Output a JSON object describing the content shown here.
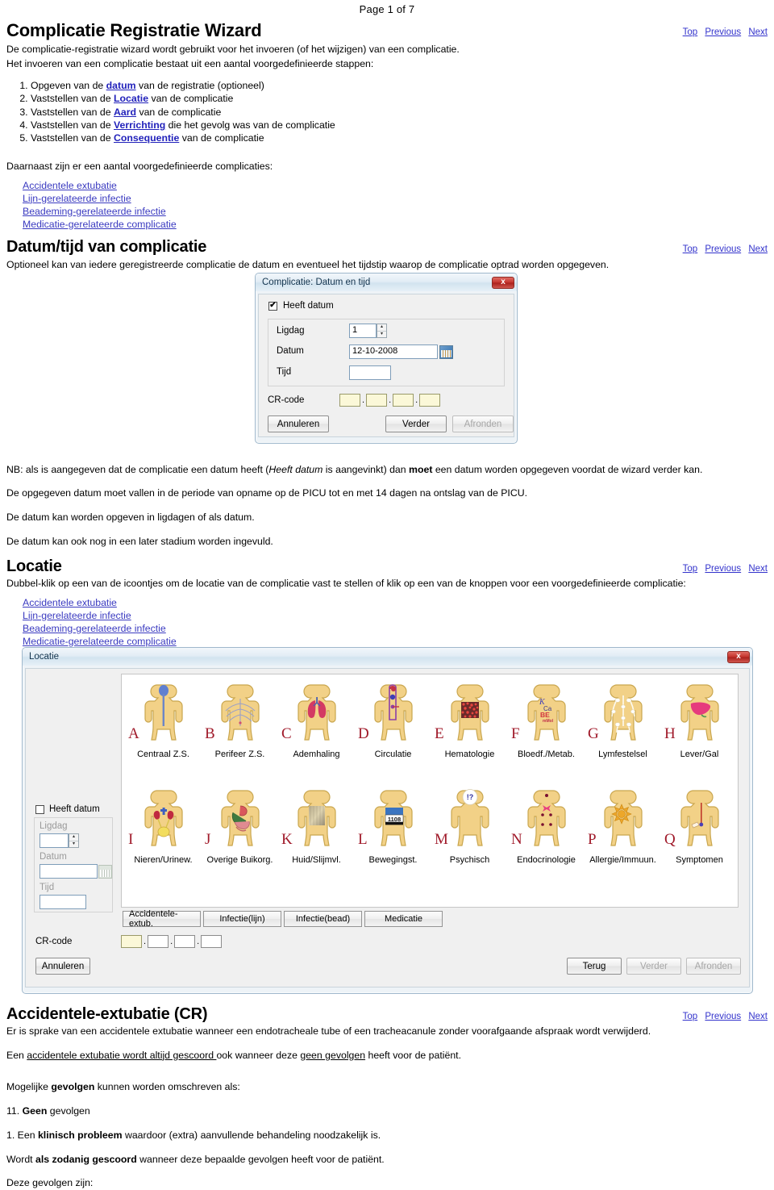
{
  "page_label": "Page 1 of 7",
  "nav": {
    "top": "Top",
    "previous": "Previous",
    "next": "Next"
  },
  "section1": {
    "title": "Complicatie Registratie Wizard",
    "intro_line1": "De complicatie-registratie wizard wordt gebruikt voor het invoeren (of het wijzigen) van een complicatie.",
    "intro_line2": "Het invoeren van een complicatie bestaat uit een aantal voorgedefinieerde stappen:",
    "steps": [
      {
        "pre": "Opgeven van de ",
        "link": "datum",
        "post": " van de registratie (optioneel)"
      },
      {
        "pre": "Vaststellen van de ",
        "link": "Locatie",
        "post": " van de complicatie"
      },
      {
        "pre": "Vaststellen van de ",
        "link": "Aard",
        "post": " van de complicatie"
      },
      {
        "pre": "Vaststellen van de ",
        "link": "Verrichting",
        "post": " die het gevolg was van de complicatie"
      },
      {
        "pre": "Vaststellen van de ",
        "link": "Consequentie",
        "post": " van de complicatie"
      }
    ],
    "predef_intro": "Daarnaast zijn er een aantal voorgedefinieerde complicaties:",
    "predef_links": [
      "Accidentele extubatie",
      "Lijn-gerelateerde infectie",
      "Beademing-gerelateerde infectie",
      "Medicatie-gerelateerde complicatie"
    ]
  },
  "section2": {
    "title": "Datum/tijd van complicatie",
    "intro": "Optioneel kan van iedere geregistreerde complicatie de datum en eventueel het tijdstip waarop de complicatie optrad worden opgegeven.",
    "notes": [
      {
        "p1": "NB: als is aangegeven dat de complicatie een datum heeft (",
        "i": "Heeft datum",
        "p2": " is aangevinkt) dan ",
        "b": "moet",
        "p3": " een datum worden opgegeven voordat de wizard verder kan."
      },
      {
        "p1": "De opgegeven datum moet vallen in de periode van opname op de PICU tot en met 14 dagen na ontslag van de PICU."
      },
      {
        "p1": "De datum kan worden opgeven in ligdagen of als datum."
      },
      {
        "p1": "De datum kan ook nog in een later stadium worden ingevuld."
      }
    ]
  },
  "dialog_datum": {
    "title": "Complicatie: Datum en tijd",
    "close_label": "x",
    "checkbox_label": "Heeft datum",
    "checkbox_checked": "✔",
    "fields": [
      {
        "label": "Ligdag",
        "value": "1"
      },
      {
        "label": "Datum",
        "value": "12-10-2008"
      },
      {
        "label": "Tijd",
        "value": ""
      }
    ],
    "crcode_label": "CR-code",
    "crcode_values": [
      "",
      "",
      "",
      ""
    ],
    "buttons": {
      "cancel": "Annuleren",
      "next": "Verder",
      "finish": "Afronden"
    }
  },
  "section3": {
    "title": "Locatie",
    "intro": "Dubbel-klik op een van de icoontjes om de locatie van de complicatie vast te stellen of klik op een van de knoppen voor een voorgedefinieerde complicatie:",
    "links": [
      "Accidentele extubatie",
      "Lijn-gerelateerde infectie",
      "Beademing-gerelateerde infectie",
      "Medicatie-gerelateerde complicatie"
    ]
  },
  "dialog_locatie": {
    "title": "Locatie",
    "close_label": "x",
    "checkbox_label": "Heeft datum",
    "fields": [
      {
        "label": "Ligdag",
        "value": ""
      },
      {
        "label": "Datum",
        "value": ""
      },
      {
        "label": "Tijd",
        "value": ""
      }
    ],
    "icons_row1": [
      {
        "letter": "A",
        "caption": "Centraal Z.S.",
        "icon": "body-central-nervous-system-icon"
      },
      {
        "letter": "B",
        "caption": "Perifeer Z.S.",
        "icon": "body-peripheral-nervous-system-icon"
      },
      {
        "letter": "C",
        "caption": "Ademhaling",
        "icon": "body-respiration-lungs-icon"
      },
      {
        "letter": "D",
        "caption": "Circulatie",
        "icon": "body-circulation-heart-icon"
      },
      {
        "letter": "E",
        "caption": "Hematologie",
        "icon": "body-hematology-blood-icon"
      },
      {
        "letter": "F",
        "caption": "Bloedf./Metab.",
        "icon": "body-metabolism-icon"
      },
      {
        "letter": "G",
        "caption": "Lymfestelsel",
        "icon": "body-lymphatic-icon"
      },
      {
        "letter": "H",
        "caption": "Lever/Gal",
        "icon": "body-liver-icon"
      }
    ],
    "icons_row2": [
      {
        "letter": "I",
        "caption": "Nieren/Urinew.",
        "icon": "body-kidneys-icon"
      },
      {
        "letter": "J",
        "caption": "Overige Buikorg.",
        "icon": "body-abdominal-organs-icon"
      },
      {
        "letter": "K",
        "caption": "Huid/Slijmvl.",
        "icon": "body-skin-icon"
      },
      {
        "letter": "L",
        "caption": "Bewegingst.",
        "icon": "body-musculoskeletal-icon"
      },
      {
        "letter": "M",
        "caption": "Psychisch",
        "icon": "body-psychological-icon"
      },
      {
        "letter": "N",
        "caption": "Endocrinologie",
        "icon": "body-endocrine-icon"
      },
      {
        "letter": "P",
        "caption": "Allergie/Immuun.",
        "icon": "body-immune-icon"
      },
      {
        "letter": "Q",
        "caption": "Symptomen",
        "icon": "body-symptoms-icon"
      }
    ],
    "metab_labels": {
      "k": "K",
      "ca": "Ca",
      "be": "BE",
      "mmol": "mMol"
    },
    "musculo_number": "1108",
    "psych_marks": "!?",
    "preset_buttons": [
      "Accidentele-extub.",
      "Infectie(lijn)",
      "Infectie(bead)",
      "Medicatie"
    ],
    "crcode_label": "CR-code",
    "crcode_values": [
      "",
      "",
      "",
      ""
    ],
    "buttons": {
      "cancel": "Annuleren",
      "back": "Terug",
      "next": "Verder",
      "finish": "Afronden"
    }
  },
  "section4": {
    "title": "Accidentele-extubatie (CR)",
    "p1": "Er is sprake van een accidentele extubatie wanneer een endotracheale tube of een tracheacanule zonder voorafgaande afspraak wordt verwijderd.",
    "p2": {
      "a": "Een ",
      "u": "accidentele extubatie wordt altijd gescoord ",
      "b": "ook wanneer deze ",
      "u2": "geen gevolgen",
      "c": " heeft voor de patiënt."
    },
    "p3": {
      "a": "Mogelijke ",
      "b": "gevolgen",
      "c": " kunnen worden omschreven als:"
    },
    "p4": {
      "n": "11. ",
      "b": "Geen",
      "c": " gevolgen"
    },
    "p5": {
      "n": "1. Een ",
      "b": "klinisch probleem",
      "c": " waardoor (extra) aanvullende behandeling noodzakelijk is."
    },
    "p6": {
      "a": "Wordt ",
      "b": "als zodanig gescoord",
      "c": " wanneer deze bepaalde gevolgen heeft voor de patiënt."
    },
    "p7": "Deze gevolgen zijn:"
  }
}
